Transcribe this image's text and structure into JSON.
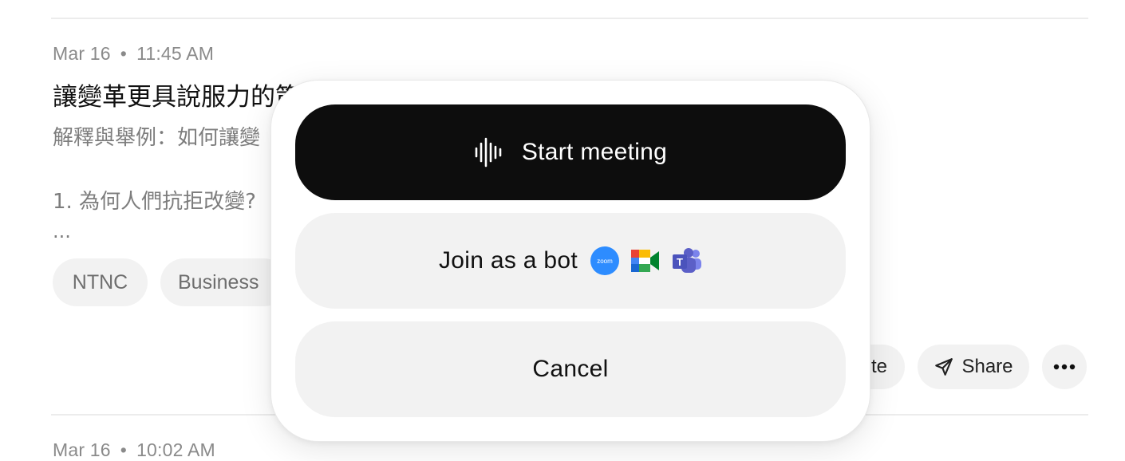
{
  "notes": [
    {
      "date": "Mar 16",
      "time": "11:45 AM",
      "title": "讓變革更具說服力的策",
      "summary": "解釋與舉例：如何讓變",
      "body_line": "1. 為何人們抗拒改變?",
      "ellipsis": "...",
      "tags": [
        "NTNC",
        "Business"
      ],
      "actions": {
        "partial_label": "te",
        "share_label": "Share"
      }
    },
    {
      "date": "Mar 16",
      "time": "10:02 AM"
    }
  ],
  "meeting_popover": {
    "start_label": "Start meeting",
    "join_bot_label": "Join as a bot",
    "cancel_label": "Cancel",
    "zoom_text": "zoom",
    "teams_letter": "T",
    "platform_icons": [
      "zoom-icon",
      "google-meet-icon",
      "microsoft-teams-icon"
    ]
  },
  "colors": {
    "primary_button": "#0d0d0d",
    "secondary_button": "#f2f2f2",
    "zoom_blue": "#2d8cff",
    "teams_purple": "#5b5fc7"
  }
}
